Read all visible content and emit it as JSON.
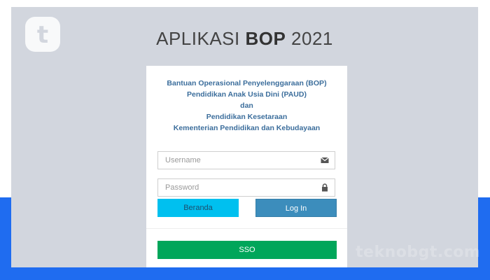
{
  "app_title": {
    "prefix": "APLIKASI ",
    "bold": "BOP",
    "suffix": " 2021"
  },
  "description_lines": [
    "Bantuan Operasional Penyelenggaraan (BOP)",
    "Pendidikan Anak Usia Dini (PAUD)",
    "dan",
    "Pendidikan Kesetaraan",
    "Kementerian Pendidikan dan Kebudayaan"
  ],
  "form": {
    "username": {
      "placeholder": "Username",
      "value": "",
      "icon": "envelope-icon"
    },
    "password": {
      "placeholder": "Password",
      "value": "",
      "icon": "lock-icon"
    }
  },
  "buttons": {
    "beranda": "Beranda",
    "login": "Log In",
    "sso": "SSO"
  },
  "watermark": "teknobgt.com",
  "brand_logo_letter": "t",
  "colors": {
    "page_background": "#d2d6de",
    "bottom_band": "#1f6cf0",
    "description_text": "#3c6e9c",
    "beranda_button": "#00c0ef",
    "login_button": "#3c8dbc",
    "sso_button": "#00a65a"
  }
}
